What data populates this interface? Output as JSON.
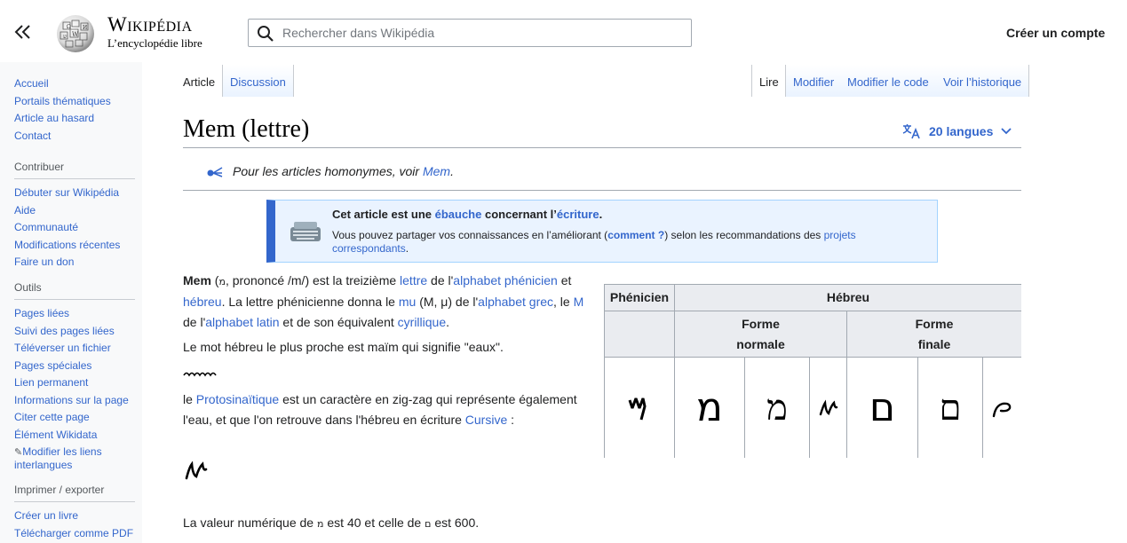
{
  "header": {
    "wordmark_title": "Wikipédia",
    "wordmark_tagline": "L’encyclopédie libre",
    "search_placeholder": "Rechercher dans Wikipédia",
    "create_account": "Créer un compte"
  },
  "sidebar": {
    "main_items": [
      "Accueil",
      "Portails thématiques",
      "Article au hasard",
      "Contact"
    ],
    "contribute_heading": "Contribuer",
    "contribute_items": [
      "Débuter sur Wikipédia",
      "Aide",
      "Communauté",
      "Modifications récentes",
      "Faire un don"
    ],
    "tools_heading": "Outils",
    "tools_items": [
      "Pages liées",
      "Suivi des pages liées",
      "Téléverser un fichier",
      "Pages spéciales",
      "Lien permanent",
      "Informations sur la page",
      "Citer cette page",
      "Élément Wikidata"
    ],
    "tools_edit_links": "Modifier les liens interlangues",
    "print_heading": "Imprimer / exporter",
    "print_items": [
      "Créer un livre",
      "Télécharger comme PDF"
    ]
  },
  "tabs": {
    "article": "Article",
    "discussion": "Discussion",
    "read": "Lire",
    "edit": "Modifier",
    "edit_source": "Modifier le code",
    "history": "Voir l’historique"
  },
  "page": {
    "title": "Mem (lettre)",
    "languages": "20 langues",
    "hatnote_prefix": "Pour les articles homonymes, voir ",
    "hatnote_link": "Mem",
    "hatnote_suffix": "."
  },
  "stub": {
    "title_prefix": "Cet article est une ",
    "title_link1": "ébauche",
    "title_middle": " concernant l’",
    "title_link2": "écriture",
    "title_suffix": ".",
    "body_prefix": "Vous pouvez partager vos connaissances en l’améliorant (",
    "body_link1": "comment ?",
    "body_middle": ") selon les recommandations des ",
    "body_link2": "projets correspondants",
    "body_suffix": "."
  },
  "content": {
    "p1": {
      "bold": "Mem",
      "t1": " (",
      "heb": "מ",
      "t2": ", prononcé /m/) est la treizième ",
      "l1": "lettre",
      "t3": " de l'",
      "l2": "alphabet phénicien",
      "t4": " et ",
      "l3": "hébreu",
      "t5": ". La lettre phénicienne donna le ",
      "l4": "mu",
      "t6": " (Μ, μ) de l'",
      "l5": "alphabet grec",
      "t7": ", le ",
      "l6": "M",
      "t8": " de l'",
      "l7": "alphabet latin",
      "t9": " et de son équivalent ",
      "l8": "cyrillique",
      "t10": "."
    },
    "p2": "Le mot hébreu le plus proche est maïm qui signifie \"eaux\".",
    "p3": {
      "t1": "le ",
      "l1": "Protosinaïtique",
      "t2": " est un caractère en zig-zag qui représente également l'eau, et que l'on retrouve dans l'hébreu en écriture ",
      "l2": "Cursive",
      "t3": " :"
    },
    "p4": {
      "t1": "La valeur numérique de ",
      "h1": "מ",
      "t2": " est 40 et celle de ",
      "h2": "ם",
      "t3": " est 600."
    }
  },
  "infobox": {
    "col_phoenician": "Phénicien",
    "col_hebrew": "Hébreu",
    "forme_normale": "Forme normale",
    "forme_finale": "Forme finale",
    "glyphs": {
      "phoenician": "𐤌",
      "normal_block": "מ",
      "normal_serif": "מ",
      "normal_cursive": "ʍ",
      "final_block": "ם",
      "final_serif": "ם",
      "final_cursive": "ρ"
    }
  }
}
